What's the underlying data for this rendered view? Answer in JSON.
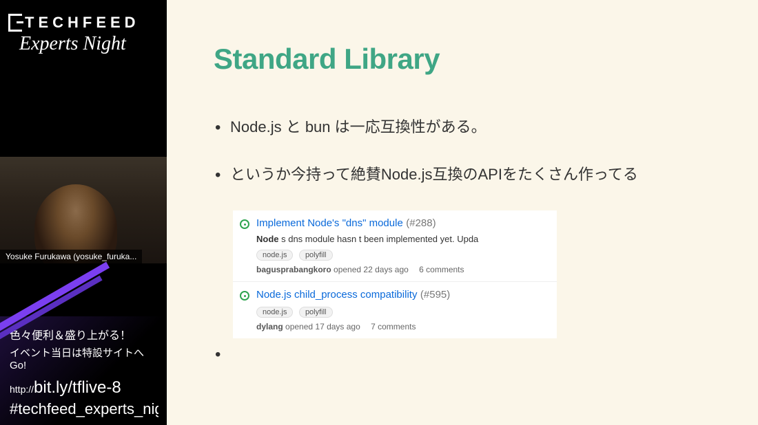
{
  "sidebar": {
    "logo_text": "TECHFEED",
    "subtitle": "Experts Night",
    "speaker_label": "Yosuke Furukawa (yosuke_furuka...",
    "promo": {
      "line1": "色々便利＆盛り上がる！",
      "line2": "イベント当日は特設サイトへGo!",
      "url_prefix": "http://",
      "url": "bit.ly/tflive-8",
      "hashtag": "#techfeed_experts_nigh"
    }
  },
  "slide": {
    "title": "Standard Library",
    "bullets": [
      "Node.js と bun は一応互換性がある。",
      "というか今持って絶賛Node.js互換のAPIをたくさん作ってる"
    ],
    "issues": [
      {
        "title": "Implement Node's \"dns\" module",
        "number": "(#288)",
        "desc_prefix": "Node",
        "desc_rest": " s dns module hasn t been implemented yet. Upda",
        "tags": [
          "node.js",
          "polyfill"
        ],
        "author": "bagusprabangkoro",
        "opened": "opened 22 days ago",
        "comments": "6 comments"
      },
      {
        "title": "Node.js child_process compatibility",
        "number": "(#595)",
        "desc_prefix": "",
        "desc_rest": "",
        "tags": [
          "node.js",
          "polyfill"
        ],
        "author": "dylang",
        "opened": "opened 17 days ago",
        "comments": "7 comments"
      }
    ]
  }
}
